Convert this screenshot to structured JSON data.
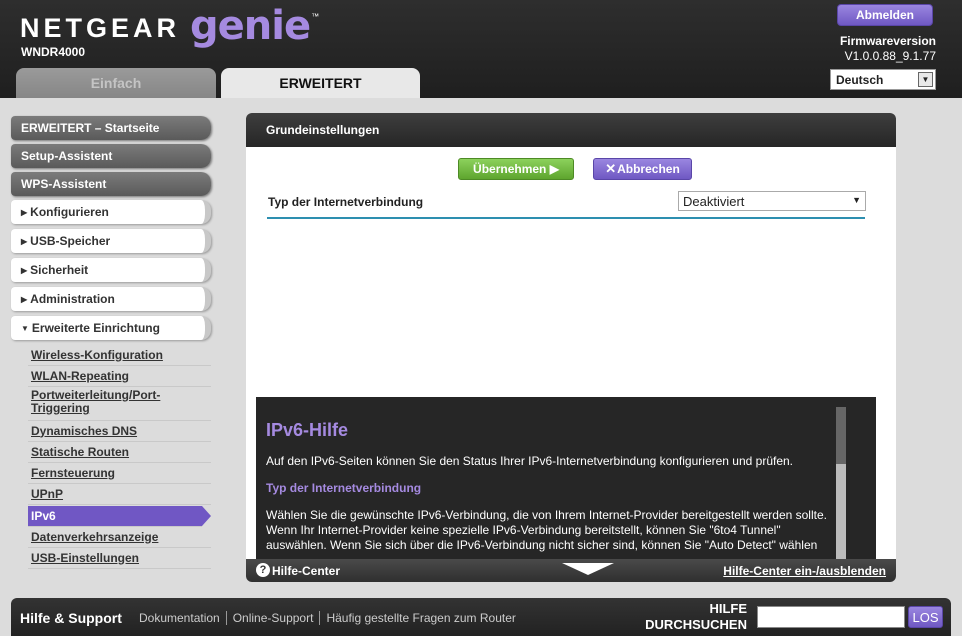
{
  "header": {
    "brand": "NETGEAR",
    "product": "genie",
    "tm": "™",
    "model": "WNDR4000",
    "logout_label": "Abmelden",
    "firmware_label": "Firmwareversion",
    "firmware_version": "V1.0.0.88_9.1.77",
    "language": "Deutsch"
  },
  "tabs": {
    "simple": "Einfach",
    "advanced": "ERWEITERT"
  },
  "sidebar": {
    "main_items": [
      "ERWEITERT – Startseite",
      "Setup-Assistent",
      "WPS-Assistent"
    ],
    "sections": [
      "Konfigurieren",
      "USB-Speicher",
      "Sicherheit",
      "Administration"
    ],
    "expanded_section": "Erweiterte Einrichtung",
    "sub_items": [
      "Wireless-Konfiguration",
      "WLAN-Repeating",
      "Portweiterleitung/Port-Triggering",
      "Dynamisches DNS",
      "Statische Routen",
      "Fernsteuerung",
      "UPnP",
      "IPv6",
      "Datenverkehrsanzeige",
      "USB-Einstellungen"
    ],
    "active_item": "IPv6"
  },
  "main": {
    "title": "Grundeinstellungen",
    "apply_label": "Übernehmen ▶",
    "cancel_label": "Abbrechen",
    "connection_type_label": "Typ der Internetverbindung",
    "connection_type_value": "Deaktiviert"
  },
  "help": {
    "title": "IPv6-Hilfe",
    "intro": "Auf den IPv6-Seiten können Sie den Status Ihrer IPv6-Internetverbindung konfigurieren und prüfen.",
    "subtitle": "Typ der Internetverbindung",
    "body": "Wählen Sie die gewünschte IPv6-Verbindung, die von Ihrem Internet-Provider bereitgestellt werden sollte. Wenn Ihr Internet-Provider keine spezielle IPv6-Verbindung bereitstellt, können Sie \"6to4 Tunnel\" auswählen. Wenn Sie sich über die IPv6-Verbindung nicht sicher sind, können Sie \"Auto Detect\" wählen",
    "center_label": "Hilfe-Center",
    "toggle_label": "Hilfe-Center ein-/ausblenden"
  },
  "footer": {
    "title": "Hilfe & Support",
    "links": [
      "Dokumentation",
      "Online-Support",
      "Häufig gestellte Fragen zum Router"
    ],
    "search_label_line1": "HILFE",
    "search_label_line2": "DURCHSUCHEN",
    "search_button": "LOS"
  },
  "colors": {
    "accent_purple": "#7057c4",
    "apply_green": "#6cb83a",
    "header_bg": "#262626",
    "help_title": "#a58ae0"
  }
}
